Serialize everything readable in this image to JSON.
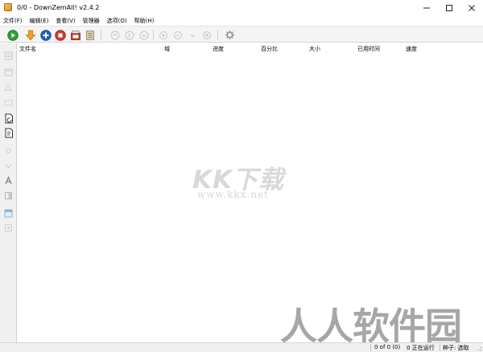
{
  "window": {
    "title": "0/0 - DownZemAll! v2.4.2",
    "controls": [
      "minimize-icon",
      "maximize-icon",
      "close-icon"
    ]
  },
  "menubar": {
    "items": [
      {
        "label": "文件(F)"
      },
      {
        "label": "编辑(E)"
      },
      {
        "label": "查看(V)"
      },
      {
        "label": "管理器"
      },
      {
        "label": "选项(O)"
      },
      {
        "label": "帮助(H)"
      }
    ]
  },
  "toolbar": {
    "buttons": [
      {
        "icon": "resume-icon",
        "color": "#2e9e3a",
        "enabled": true
      },
      {
        "icon": "download-arrow-icon",
        "color": "#f0a21c",
        "enabled": true
      },
      {
        "icon": "add-icon",
        "color": "#1e63c4",
        "enabled": true
      },
      {
        "icon": "stop-icon",
        "color": "#d23a2f",
        "enabled": true
      },
      {
        "icon": "queue-icon",
        "color": "#c0392b",
        "enabled": true
      },
      {
        "icon": "clipboard-icon",
        "color": "#8a7a5c",
        "enabled": true
      },
      {
        "icon": "move-top-icon",
        "enabled": false
      },
      {
        "icon": "move-up-icon",
        "enabled": false
      },
      {
        "icon": "move-down-icon",
        "enabled": false
      },
      {
        "icon": "move-bottom-icon",
        "enabled": false
      },
      {
        "icon": "priority-up-icon",
        "enabled": false
      },
      {
        "icon": "priority-down-icon",
        "enabled": false
      },
      {
        "icon": "remove-icon",
        "enabled": false
      },
      {
        "icon": "settings-gear-icon",
        "enabled": false
      }
    ]
  },
  "sidebar": {
    "buttons": [
      {
        "icon": "info-icon"
      },
      {
        "icon": "open-file-icon"
      },
      {
        "icon": "folder-icon"
      },
      {
        "icon": "blank-icon"
      },
      {
        "icon": "redownload-file-icon"
      },
      {
        "icon": "rename-file-icon"
      },
      {
        "icon": "link-icon"
      },
      {
        "icon": "filter-icon"
      },
      {
        "icon": "font-icon"
      },
      {
        "icon": "copy-icon"
      },
      {
        "icon": "image-icon"
      },
      {
        "icon": "properties-icon"
      }
    ]
  },
  "list": {
    "columns": [
      "文件名",
      "域",
      "进度",
      "百分比",
      "大小",
      "已用时间",
      "速度"
    ],
    "rows": []
  },
  "watermark": {
    "logo": "KK下载",
    "url": "www.kkx.net",
    "corner": "人人软件园"
  },
  "statusbar": {
    "counts": "0 of 0 (0)",
    "running": "0 正在运行",
    "torrent": "种子: 选取"
  }
}
